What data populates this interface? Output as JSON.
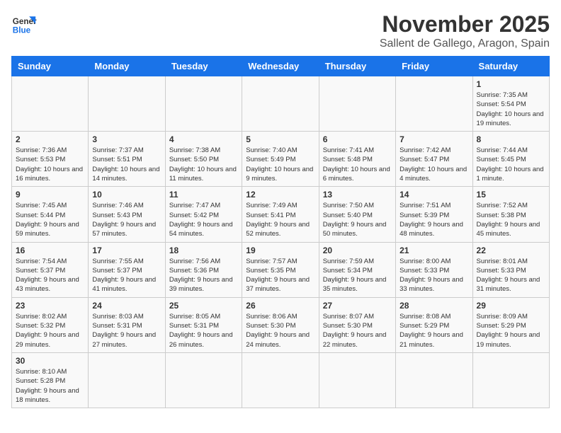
{
  "header": {
    "logo_general": "General",
    "logo_blue": "Blue",
    "month": "November 2025",
    "location": "Sallent de Gallego, Aragon, Spain"
  },
  "days_of_week": [
    "Sunday",
    "Monday",
    "Tuesday",
    "Wednesday",
    "Thursday",
    "Friday",
    "Saturday"
  ],
  "weeks": [
    [
      {
        "day": "",
        "info": ""
      },
      {
        "day": "",
        "info": ""
      },
      {
        "day": "",
        "info": ""
      },
      {
        "day": "",
        "info": ""
      },
      {
        "day": "",
        "info": ""
      },
      {
        "day": "",
        "info": ""
      },
      {
        "day": "1",
        "info": "Sunrise: 7:35 AM\nSunset: 5:54 PM\nDaylight: 10 hours and 19 minutes."
      }
    ],
    [
      {
        "day": "2",
        "info": "Sunrise: 7:36 AM\nSunset: 5:53 PM\nDaylight: 10 hours and 16 minutes."
      },
      {
        "day": "3",
        "info": "Sunrise: 7:37 AM\nSunset: 5:51 PM\nDaylight: 10 hours and 14 minutes."
      },
      {
        "day": "4",
        "info": "Sunrise: 7:38 AM\nSunset: 5:50 PM\nDaylight: 10 hours and 11 minutes."
      },
      {
        "day": "5",
        "info": "Sunrise: 7:40 AM\nSunset: 5:49 PM\nDaylight: 10 hours and 9 minutes."
      },
      {
        "day": "6",
        "info": "Sunrise: 7:41 AM\nSunset: 5:48 PM\nDaylight: 10 hours and 6 minutes."
      },
      {
        "day": "7",
        "info": "Sunrise: 7:42 AM\nSunset: 5:47 PM\nDaylight: 10 hours and 4 minutes."
      },
      {
        "day": "8",
        "info": "Sunrise: 7:44 AM\nSunset: 5:45 PM\nDaylight: 10 hours and 1 minute."
      }
    ],
    [
      {
        "day": "9",
        "info": "Sunrise: 7:45 AM\nSunset: 5:44 PM\nDaylight: 9 hours and 59 minutes."
      },
      {
        "day": "10",
        "info": "Sunrise: 7:46 AM\nSunset: 5:43 PM\nDaylight: 9 hours and 57 minutes."
      },
      {
        "day": "11",
        "info": "Sunrise: 7:47 AM\nSunset: 5:42 PM\nDaylight: 9 hours and 54 minutes."
      },
      {
        "day": "12",
        "info": "Sunrise: 7:49 AM\nSunset: 5:41 PM\nDaylight: 9 hours and 52 minutes."
      },
      {
        "day": "13",
        "info": "Sunrise: 7:50 AM\nSunset: 5:40 PM\nDaylight: 9 hours and 50 minutes."
      },
      {
        "day": "14",
        "info": "Sunrise: 7:51 AM\nSunset: 5:39 PM\nDaylight: 9 hours and 48 minutes."
      },
      {
        "day": "15",
        "info": "Sunrise: 7:52 AM\nSunset: 5:38 PM\nDaylight: 9 hours and 45 minutes."
      }
    ],
    [
      {
        "day": "16",
        "info": "Sunrise: 7:54 AM\nSunset: 5:37 PM\nDaylight: 9 hours and 43 minutes."
      },
      {
        "day": "17",
        "info": "Sunrise: 7:55 AM\nSunset: 5:37 PM\nDaylight: 9 hours and 41 minutes."
      },
      {
        "day": "18",
        "info": "Sunrise: 7:56 AM\nSunset: 5:36 PM\nDaylight: 9 hours and 39 minutes."
      },
      {
        "day": "19",
        "info": "Sunrise: 7:57 AM\nSunset: 5:35 PM\nDaylight: 9 hours and 37 minutes."
      },
      {
        "day": "20",
        "info": "Sunrise: 7:59 AM\nSunset: 5:34 PM\nDaylight: 9 hours and 35 minutes."
      },
      {
        "day": "21",
        "info": "Sunrise: 8:00 AM\nSunset: 5:33 PM\nDaylight: 9 hours and 33 minutes."
      },
      {
        "day": "22",
        "info": "Sunrise: 8:01 AM\nSunset: 5:33 PM\nDaylight: 9 hours and 31 minutes."
      }
    ],
    [
      {
        "day": "23",
        "info": "Sunrise: 8:02 AM\nSunset: 5:32 PM\nDaylight: 9 hours and 29 minutes."
      },
      {
        "day": "24",
        "info": "Sunrise: 8:03 AM\nSunset: 5:31 PM\nDaylight: 9 hours and 27 minutes."
      },
      {
        "day": "25",
        "info": "Sunrise: 8:05 AM\nSunset: 5:31 PM\nDaylight: 9 hours and 26 minutes."
      },
      {
        "day": "26",
        "info": "Sunrise: 8:06 AM\nSunset: 5:30 PM\nDaylight: 9 hours and 24 minutes."
      },
      {
        "day": "27",
        "info": "Sunrise: 8:07 AM\nSunset: 5:30 PM\nDaylight: 9 hours and 22 minutes."
      },
      {
        "day": "28",
        "info": "Sunrise: 8:08 AM\nSunset: 5:29 PM\nDaylight: 9 hours and 21 minutes."
      },
      {
        "day": "29",
        "info": "Sunrise: 8:09 AM\nSunset: 5:29 PM\nDaylight: 9 hours and 19 minutes."
      }
    ],
    [
      {
        "day": "30",
        "info": "Sunrise: 8:10 AM\nSunset: 5:28 PM\nDaylight: 9 hours and 18 minutes."
      },
      {
        "day": "",
        "info": ""
      },
      {
        "day": "",
        "info": ""
      },
      {
        "day": "",
        "info": ""
      },
      {
        "day": "",
        "info": ""
      },
      {
        "day": "",
        "info": ""
      },
      {
        "day": "",
        "info": ""
      }
    ]
  ]
}
